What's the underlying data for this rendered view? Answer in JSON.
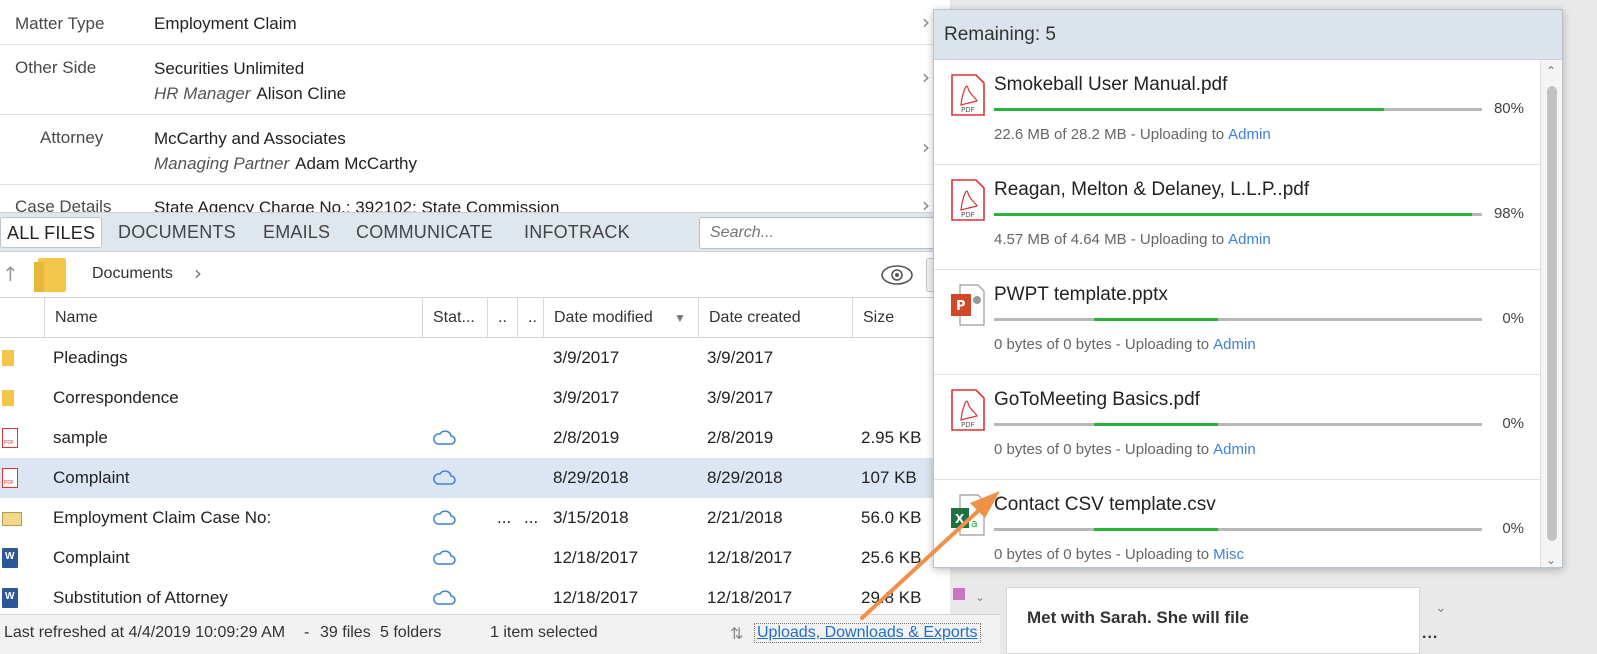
{
  "details": {
    "matter_type_label": "Matter Type",
    "matter_type_value": "Employment Claim",
    "other_side_label": "Other Side",
    "other_side_company": "Securities Unlimited",
    "other_side_role": "HR Manager",
    "other_side_person": "Alison Cline",
    "attorney_label": "Attorney",
    "attorney_company": "McCarthy and Associates",
    "attorney_role": "Managing Partner",
    "attorney_person": "Adam McCarthy",
    "case_details_label": "Case Details",
    "case_details_value": "State Agency Charge No.: 392102; State Commission"
  },
  "tabs": [
    "ALL FILES",
    "DOCUMENTS",
    "EMAILS",
    "COMMUNICATE",
    "INFOTRACK"
  ],
  "search": {
    "placeholder": "Search..."
  },
  "breadcrumb": {
    "folder": "Documents"
  },
  "table": {
    "headers": {
      "name": "Name",
      "status": "Stat...",
      "c1": "..",
      "c2": "..",
      "modified": "Date modified",
      "created": "Date created",
      "size": "Size"
    },
    "sort_indicator": "▼",
    "rows": [
      {
        "name": "Pleadings",
        "type": "folder",
        "cloud": false,
        "dots1": "",
        "dots2": "",
        "modified": "3/9/2017",
        "created": "3/9/2017",
        "size": ""
      },
      {
        "name": "Correspondence",
        "type": "folder",
        "cloud": false,
        "dots1": "",
        "dots2": "",
        "modified": "3/9/2017",
        "created": "3/9/2017",
        "size": ""
      },
      {
        "name": "sample",
        "type": "pdf",
        "cloud": true,
        "dots1": "",
        "dots2": "",
        "modified": "2/8/2019",
        "created": "2/8/2019",
        "size": "2.95 KB"
      },
      {
        "name": "Complaint",
        "type": "pdf",
        "cloud": true,
        "dots1": "",
        "dots2": "",
        "modified": "8/29/2018",
        "created": "8/29/2018",
        "size": "107 KB",
        "selected": true
      },
      {
        "name": "Employment Claim Case No:",
        "type": "email",
        "cloud": true,
        "dots1": "...",
        "dots2": "...",
        "modified": "3/15/2018",
        "created": "2/21/2018",
        "size": "56.0 KB"
      },
      {
        "name": "Complaint",
        "type": "word",
        "cloud": true,
        "dots1": "",
        "dots2": "",
        "modified": "12/18/2017",
        "created": "12/18/2017",
        "size": "25.6 KB"
      },
      {
        "name": "Substitution of Attorney",
        "type": "word",
        "cloud": true,
        "dots1": "",
        "dots2": "",
        "modified": "12/18/2017",
        "created": "12/18/2017",
        "size": "29.8 KB"
      }
    ]
  },
  "status": {
    "refreshed": "Last refreshed at 4/4/2019 10:09:29 AM",
    "sep": "-",
    "files": "39 files",
    "folders": "5 folders",
    "selected": "1 item selected",
    "sort_icon": "⇅",
    "uploads_link": "Uploads, Downloads & Exports"
  },
  "right_panel": {
    "note": "Met with Sarah. She will file",
    "more": "..."
  },
  "uploads": {
    "remaining": "Remaining: 5",
    "items": [
      {
        "name": "Smokeball User Manual.pdf",
        "icon": "pdf-icon",
        "progress": 80,
        "pct": "80%",
        "detail": "22.6 MB of 28.2 MB - Uploading to",
        "dest": "Admin"
      },
      {
        "name": "Reagan, Melton & Delaney, L.L.P..pdf",
        "icon": "pdf-icon",
        "progress": 98,
        "pct": "98%",
        "detail": "4.57 MB of 4.64 MB - Uploading to",
        "dest": "Admin"
      },
      {
        "name": "PWPT template.pptx",
        "icon": "powerpoint-icon",
        "progress": 0,
        "pct": "0%",
        "detail": "0 bytes of 0 bytes - Uploading to",
        "dest": "Admin"
      },
      {
        "name": "GoToMeeting Basics.pdf",
        "icon": "pdf-icon",
        "progress": 0,
        "pct": "0%",
        "detail": "0 bytes of 0 bytes - Uploading to",
        "dest": "Admin"
      },
      {
        "name": "Contact CSV template.csv",
        "icon": "excel-icon",
        "progress": 0,
        "pct": "0%",
        "detail": "0 bytes of 0 bytes - Uploading to",
        "dest": "Misc"
      }
    ]
  },
  "colors": {
    "accent": "#3c82d6",
    "progress": "#2bb23b",
    "annotation_arrow": "#f0914a",
    "selected_row": "#dbe6f2"
  }
}
